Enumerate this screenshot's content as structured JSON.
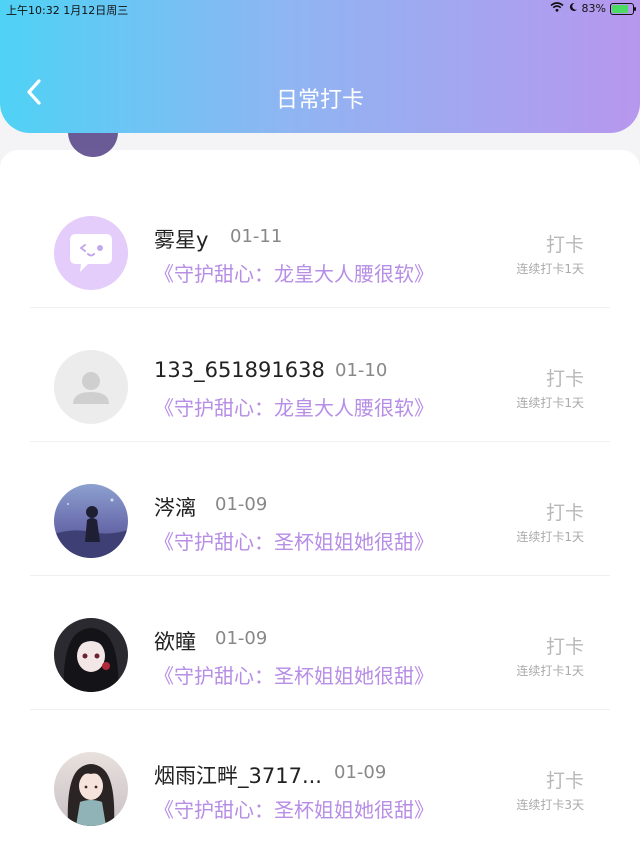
{
  "status_bar": {
    "time": "上午10:32  1月12日周三",
    "battery": "83%"
  },
  "header": {
    "title": "日常打卡"
  },
  "entries": [
    {
      "name": "雾星y",
      "date": "01-11",
      "book": "《守护甜心：龙皇大人腰很软》",
      "action": "打卡",
      "streak": "连续打卡1天"
    },
    {
      "name": "133_651891638",
      "date": "01-10",
      "book": "《守护甜心：龙皇大人腰很软》",
      "action": "打卡",
      "streak": "连续打卡1天"
    },
    {
      "name": "涔漓",
      "date": "01-09",
      "book": "《守护甜心：圣杯姐姐她很甜》",
      "action": "打卡",
      "streak": "连续打卡1天"
    },
    {
      "name": "欲瞳",
      "date": "01-09",
      "book": "《守护甜心：圣杯姐姐她很甜》",
      "action": "打卡",
      "streak": "连续打卡1天"
    },
    {
      "name": "烟雨江畔_3717...",
      "date": "01-09",
      "book": "《守护甜心：圣杯姐姐她很甜》",
      "action": "打卡",
      "streak": "连续打卡3天"
    }
  ]
}
